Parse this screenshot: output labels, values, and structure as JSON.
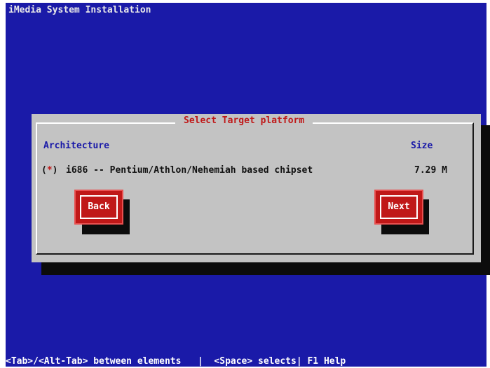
{
  "window": {
    "title": "iMedia System Installation",
    "status_bar": "<Tab>/<Alt-Tab> between elements   |  <Space> selects| F1 Help"
  },
  "dialog": {
    "title": "Select Target platform",
    "columns": [
      "Architecture",
      "Size"
    ],
    "options": [
      {
        "marker": "*",
        "label": "i686 -- Pentium/Athlon/Nehemiah based chipset",
        "size": "7.29 M",
        "selected": true
      }
    ],
    "buttons": {
      "back": "Back",
      "next": "Next"
    }
  },
  "colors": {
    "background": "#1a1aa8",
    "dialog": "#c3c3c3",
    "accent": "#c01818",
    "header_text": "#1a1aa8"
  }
}
